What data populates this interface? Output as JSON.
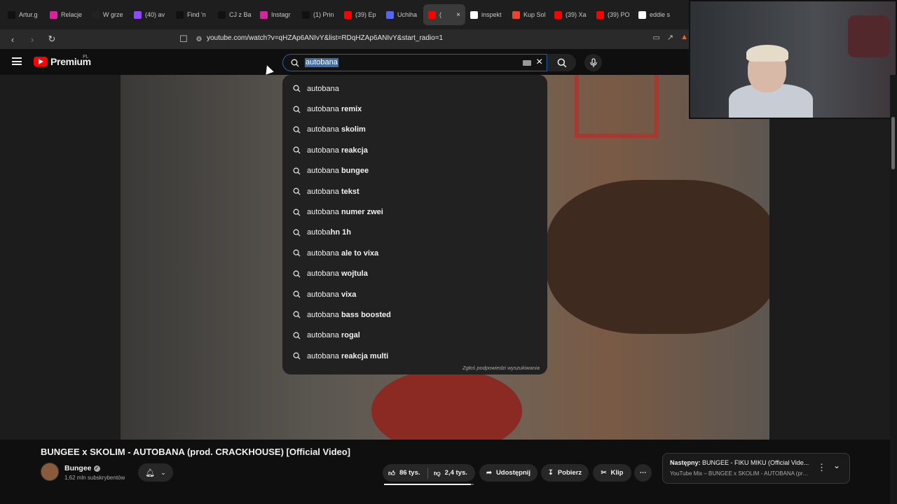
{
  "browser": {
    "tabs": [
      {
        "label": "Artur.g",
        "icon": "tiktok-icon",
        "color": "#111111"
      },
      {
        "label": "Relacje",
        "icon": "instagram-icon",
        "color": "#d6249f"
      },
      {
        "label": "W grze",
        "icon": "mm-icon",
        "color": "#222222"
      },
      {
        "label": "(40) av",
        "icon": "twitch-icon",
        "color": "#9146ff"
      },
      {
        "label": "Find 'n",
        "icon": "tiktok-icon",
        "color": "#111111"
      },
      {
        "label": "CJ z Ba",
        "icon": "x-icon",
        "color": "#111111"
      },
      {
        "label": "Instagr",
        "icon": "instagram-icon",
        "color": "#d6249f"
      },
      {
        "label": "(1) Prin",
        "icon": "x-icon",
        "color": "#111111"
      },
      {
        "label": "(39) Ep",
        "icon": "youtube-icon",
        "color": "#ff0000"
      },
      {
        "label": "Uchiha",
        "icon": "discord-icon",
        "color": "#5865f2"
      },
      {
        "label": "(",
        "icon": "youtube-icon",
        "color": "#ff0000",
        "active": true
      },
      {
        "label": "inspekt",
        "icon": "google-icon",
        "color": "#ffffff"
      },
      {
        "label": "Kup Sol",
        "icon": "play-icon",
        "color": "#e8452c"
      },
      {
        "label": "(39) Xa",
        "icon": "youtube-icon",
        "color": "#ff0000"
      },
      {
        "label": "(39) PO",
        "icon": "youtube-icon",
        "color": "#ff0000"
      },
      {
        "label": "eddie s",
        "icon": "google-icon",
        "color": "#ffffff"
      }
    ],
    "url": "youtube.com/watch?v=qHZAp6ANIvY&list=RDqHZAp6ANIvY&start_radio=1",
    "active_tab_close": "×"
  },
  "header": {
    "logo_text": "Premium",
    "logo_region": "PL"
  },
  "search": {
    "query": "autobana",
    "suggestions": [
      {
        "prefix": "autobana",
        "suffix": ""
      },
      {
        "prefix": "autobana",
        "suffix": " remix"
      },
      {
        "prefix": "autobana",
        "suffix": " skolim"
      },
      {
        "prefix": "autobana",
        "suffix": " reakcja"
      },
      {
        "prefix": "autobana",
        "suffix": " bungee"
      },
      {
        "prefix": "autobana",
        "suffix": " tekst"
      },
      {
        "prefix": "autobana",
        "suffix": " numer zwei"
      },
      {
        "prefix": "autoba",
        "suffix": "hn 1h"
      },
      {
        "prefix": "autobana",
        "suffix": " ale to vixa"
      },
      {
        "prefix": "autobana",
        "suffix": " wojtula"
      },
      {
        "prefix": "autobana",
        "suffix": " vixa"
      },
      {
        "prefix": "autobana",
        "suffix": " bass boosted"
      },
      {
        "prefix": "autobana",
        "suffix": " rogal"
      },
      {
        "prefix": "autobana",
        "suffix": " reakcja multi"
      }
    ],
    "report_text": "Zgłoś podpowiedzi wyszukiwania"
  },
  "video": {
    "title": "BUNGEE x SKOLIM - AUTOBANA (prod. CRACKHOUSE) [Official Video]",
    "channel": "Bungee",
    "subscribers": "1,62 mln subskrybentów",
    "likes": "86 tys.",
    "dislikes": "2,4 tys.",
    "like_ratio": 0.97,
    "share_label": "Udostępnij",
    "download_label": "Pobierz",
    "clip_label": "Klip"
  },
  "up_next": {
    "label": "Następny:",
    "title": "BUNGEE - FIKU MIKU (Official Vide...",
    "subtitle": "YouTube Mix – BUNGEE x SKOLIM - AUTOBANA (pro..."
  }
}
